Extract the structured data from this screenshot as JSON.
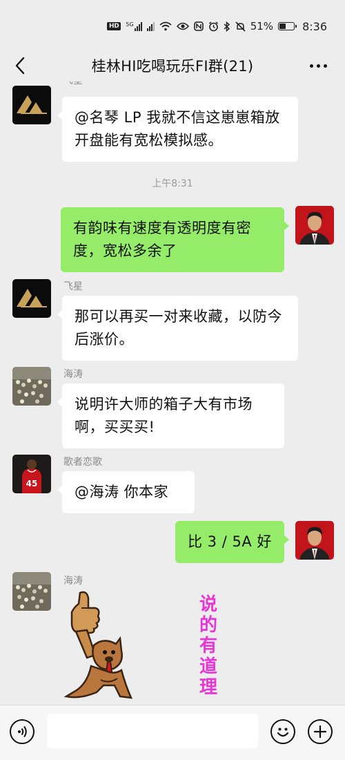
{
  "status_bar": {
    "network_badge": "HD",
    "signal_1_label": "5G",
    "battery_percent": "51%",
    "battery_level": 0.51,
    "time": "8:36",
    "icons": [
      "hd-icon",
      "signal-5g-icon",
      "signal-icon",
      "wifi-icon",
      "eye-icon",
      "nfc-icon",
      "alarm-icon",
      "bluetooth-icon",
      "mute-icon",
      "battery-icon"
    ]
  },
  "header": {
    "title": "桂林HI吃喝玩乐FI群(21)",
    "back_icon": "chevron-left-icon",
    "more_icon": "more-horizontal-icon"
  },
  "messages": [
    {
      "type": "text",
      "direction": "in",
      "sender": "飞星",
      "avatar": "logo-avatar",
      "text": "@名琴 LP  我就不信这崽崽箱放开盘能有宽松模拟感。"
    },
    {
      "type": "time",
      "text": "上午8:31"
    },
    {
      "type": "text",
      "direction": "out",
      "avatar": "man-avatar",
      "text": "有韵味有速度有透明度有密度，宽松多余了"
    },
    {
      "type": "text",
      "direction": "in",
      "sender": "飞星",
      "avatar": "logo-avatar",
      "text": "那可以再买一对来收藏，以防今后涨价。"
    },
    {
      "type": "text",
      "direction": "in",
      "sender": "海涛",
      "avatar": "crowd-avatar",
      "text": "说明许大师的箱子大有市场啊，买买买!"
    },
    {
      "type": "text",
      "direction": "in",
      "sender": "歌者恋歌",
      "avatar": "jersey-avatar",
      "text": "@海涛  你本家"
    },
    {
      "type": "text",
      "direction": "out",
      "avatar": "man-avatar",
      "text": "比 3 / 5A 好"
    },
    {
      "type": "sticker",
      "direction": "in",
      "sender": "海涛",
      "avatar": "crowd-avatar",
      "sticker_text": "说\n的\n有\n道\n理",
      "sticker_icon": "thumbs-up-dog-icon"
    }
  ],
  "input_bar": {
    "value": "",
    "placeholder": "",
    "voice_icon": "voice-icon",
    "emoji_icon": "emoji-icon",
    "plus_icon": "plus-icon"
  },
  "colors": {
    "background": "#ededed",
    "bubble_in": "#ffffff",
    "bubble_out": "#95ec69",
    "sticker_text": "#e636d6"
  }
}
